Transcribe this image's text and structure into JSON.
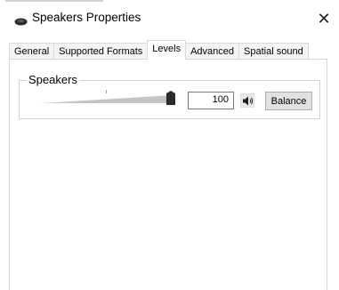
{
  "window": {
    "title": "Speakers Properties",
    "close_glyph": "✕"
  },
  "tabs": [
    {
      "label": "General",
      "active": false
    },
    {
      "label": "Supported Formats",
      "active": false
    },
    {
      "label": "Levels",
      "active": true
    },
    {
      "label": "Advanced",
      "active": false
    },
    {
      "label": "Spatial sound",
      "active": false
    }
  ],
  "levels": {
    "group_label": "Speakers",
    "volume_value": "100",
    "volume_fraction": 1.0,
    "balance_label": "Balance",
    "mute_icon": "speaker-icon"
  },
  "colors": {
    "border": "#d9d9d9",
    "button_face": "#e1e1e1",
    "slider_ramp": "#c4c4c4",
    "slider_thumb": "#2b2b2b"
  }
}
